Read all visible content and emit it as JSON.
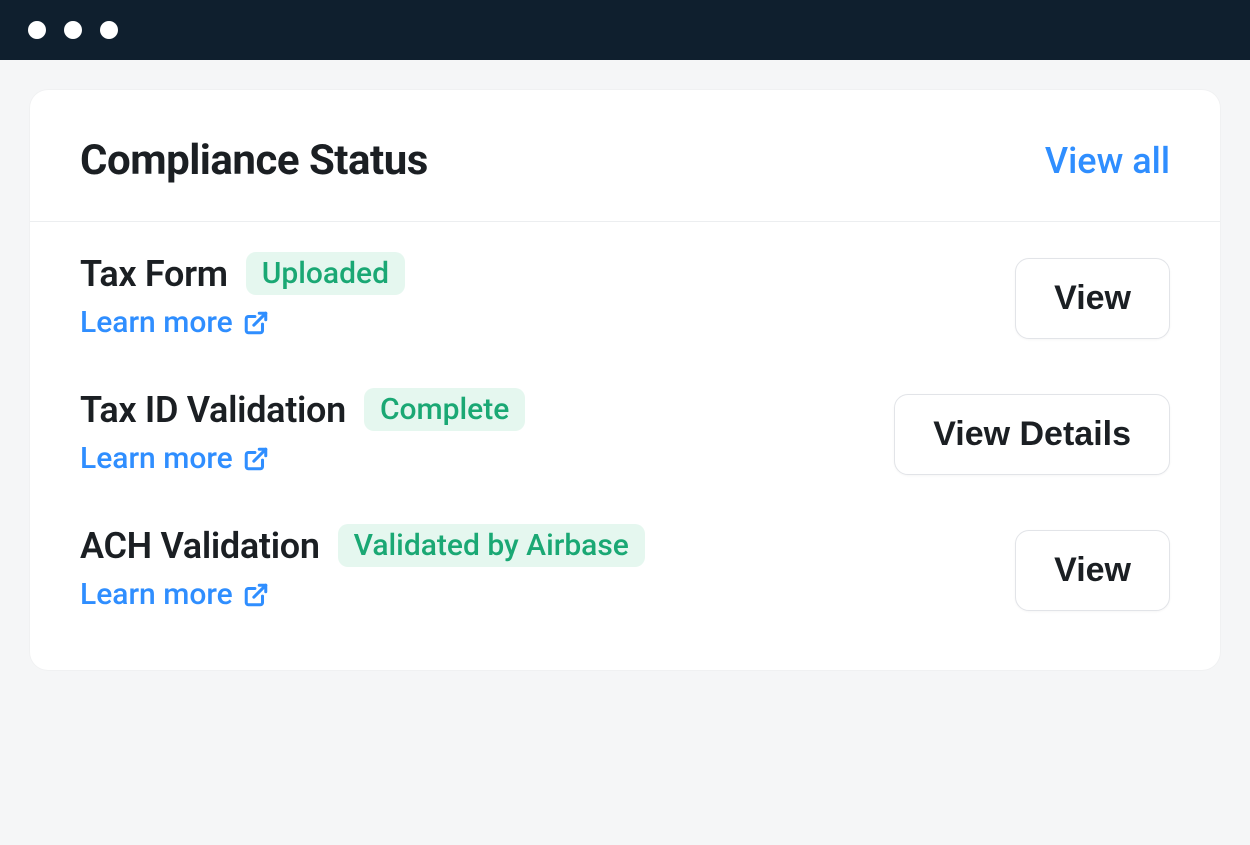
{
  "header": {
    "title": "Compliance Status",
    "view_all": "View all"
  },
  "items": [
    {
      "title": "Tax Form",
      "badge": "Uploaded",
      "learn_more": "Learn more",
      "action": "View"
    },
    {
      "title": "Tax ID Validation",
      "badge": "Complete",
      "learn_more": "Learn more",
      "action": "View Details"
    },
    {
      "title": "ACH Validation",
      "badge": "Validated by Airbase",
      "learn_more": "Learn more",
      "action": "View"
    }
  ]
}
